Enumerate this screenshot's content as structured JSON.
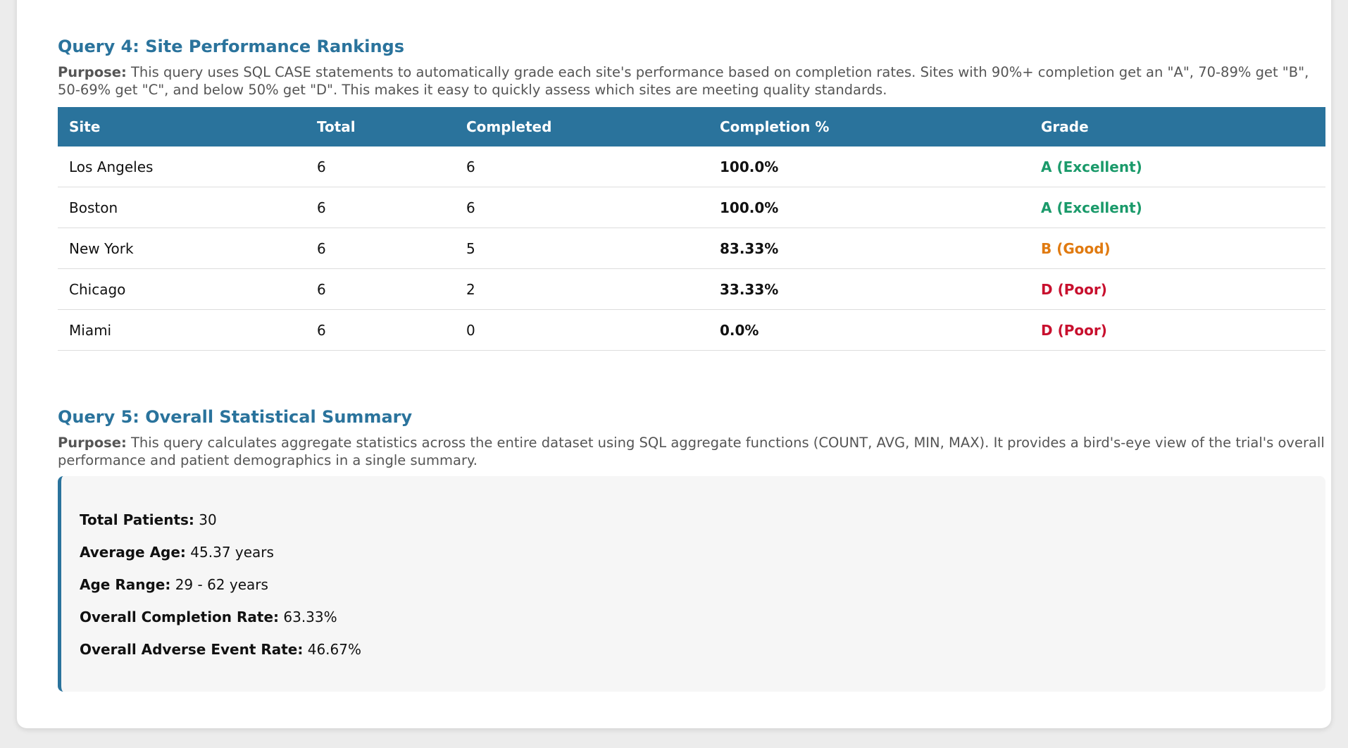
{
  "query4": {
    "title": "Query 4: Site Performance Rankings",
    "purpose_label": "Purpose:",
    "purpose_text": " This query uses SQL CASE statements to automatically grade each site's performance based on completion rates. Sites with 90%+ completion get an \"A\", 70-89% get \"B\", 50-69% get \"C\", and below 50% get \"D\". This makes it easy to quickly assess which sites are meeting quality standards.",
    "columns": [
      "Site",
      "Total",
      "Completed",
      "Completion %",
      "Grade"
    ],
    "rows": [
      {
        "site": "Los Angeles",
        "total": "6",
        "completed": "6",
        "pct": "100.0%",
        "grade": "A (Excellent)",
        "grade_color": "#1a9a6a"
      },
      {
        "site": "Boston",
        "total": "6",
        "completed": "6",
        "pct": "100.0%",
        "grade": "A (Excellent)",
        "grade_color": "#1a9a6a"
      },
      {
        "site": "New York",
        "total": "6",
        "completed": "5",
        "pct": "83.33%",
        "grade": "B (Good)",
        "grade_color": "#e07a10"
      },
      {
        "site": "Chicago",
        "total": "6",
        "completed": "2",
        "pct": "33.33%",
        "grade": "D (Poor)",
        "grade_color": "#c8102e"
      },
      {
        "site": "Miami",
        "total": "6",
        "completed": "0",
        "pct": "0.0%",
        "grade": "D (Poor)",
        "grade_color": "#c8102e"
      }
    ]
  },
  "query5": {
    "title": "Query 5: Overall Statistical Summary",
    "purpose_label": "Purpose:",
    "purpose_text": " This query calculates aggregate statistics across the entire dataset using SQL aggregate functions (COUNT, AVG, MIN, MAX). It provides a bird's-eye view of the trial's overall performance and patient demographics in a single summary.",
    "stats": [
      {
        "label": "Total Patients:",
        "value": " 30"
      },
      {
        "label": "Average Age:",
        "value": " 45.37 years"
      },
      {
        "label": "Age Range:",
        "value": " 29 - 62 years"
      },
      {
        "label": "Overall Completion Rate:",
        "value": " 63.33%"
      },
      {
        "label": "Overall Adverse Event Rate:",
        "value": " 46.67%"
      }
    ]
  },
  "colors": {
    "accent": "#2a739c",
    "grade_a": "#1a9a6a",
    "grade_b": "#e07a10",
    "grade_d": "#c8102e"
  }
}
